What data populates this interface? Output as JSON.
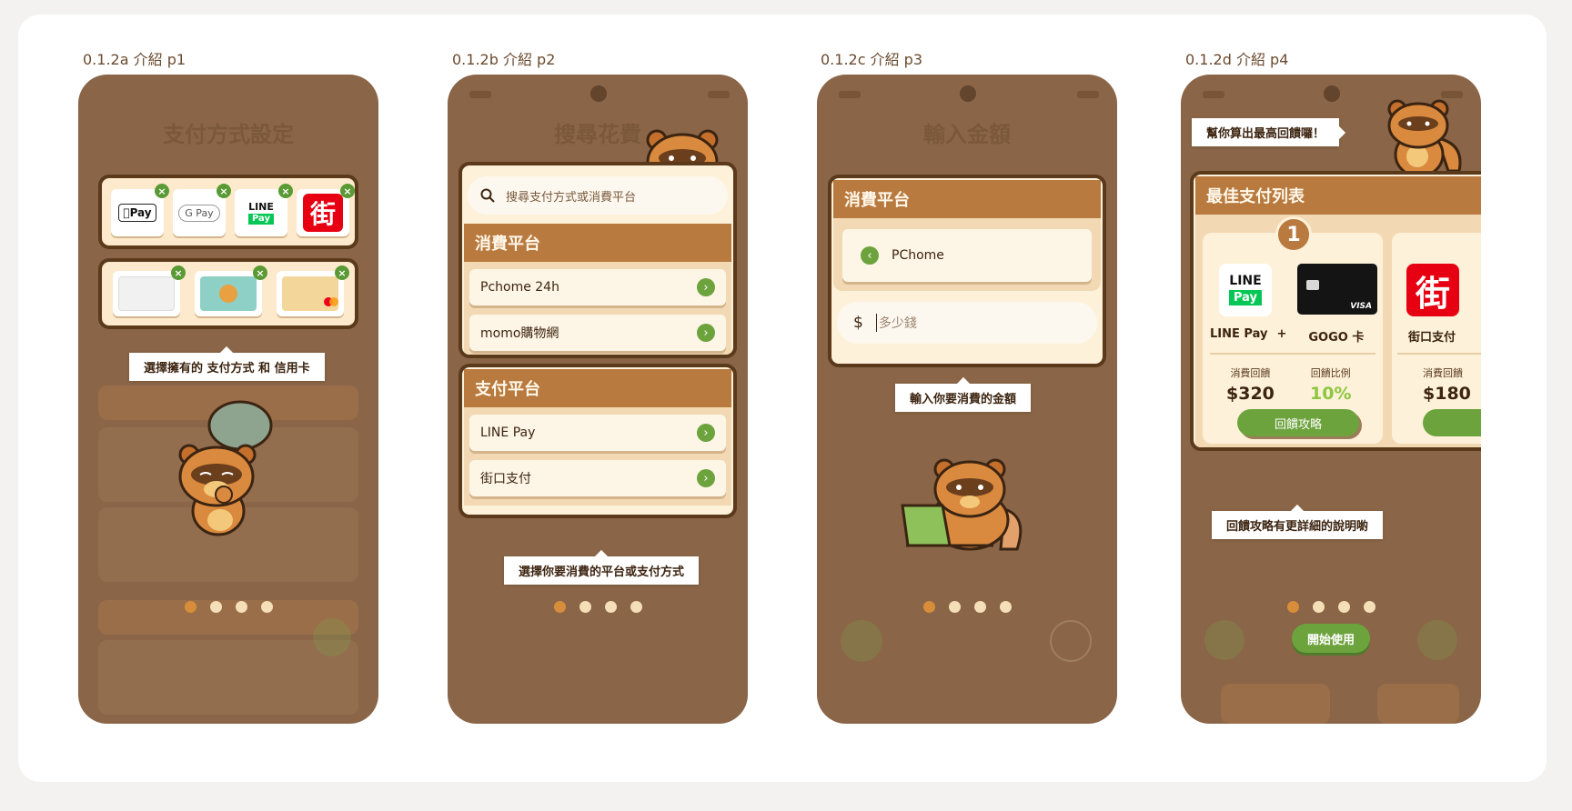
{
  "frames": [
    {
      "label": "0.1.2a 介紹 p1",
      "ghost_title": "支付方式設定",
      "tip": "選擇擁有的 支付方式 和 信用卡",
      "payment_tiles": [
        {
          "name": "apple-pay",
          "text": "Pay"
        },
        {
          "name": "google-pay",
          "text": "G Pay"
        },
        {
          "name": "line-pay",
          "text_top": "LINE",
          "text_bottom": "Pay"
        },
        {
          "name": "jkopay",
          "text": "街"
        }
      ]
    },
    {
      "label": "0.1.2b 介紹 p2",
      "ghost_title": "搜尋花費",
      "search_placeholder": "搜尋支付方式或消費平台",
      "consume_header": "消費平台",
      "consume_items": [
        "Pchome 24h",
        "momo購物網"
      ],
      "pay_header": "支付平台",
      "pay_items": [
        "LINE Pay",
        "街口支付"
      ],
      "tip": "選擇你要消費的平台或支付方式"
    },
    {
      "label": "0.1.2c 介紹 p3",
      "ghost_title": "輸入金額",
      "consume_header": "消費平台",
      "selected": "PChome",
      "currency": "$",
      "amount_placeholder": "多少錢",
      "tip": "輸入你要消費的金額"
    },
    {
      "label": "0.1.2d 介紹 p4",
      "speech": "幫你算出最高回饋囉！",
      "list_header": "最佳支付列表",
      "rank": "1",
      "logo_line_top": "LINE",
      "logo_line_bottom": "Pay",
      "logo_jko": "街",
      "card_left": "LINE Pay",
      "card_plus": "+",
      "card_right": "GOGO 卡",
      "card_third": "街口支付",
      "reward_label": "消費回饋",
      "reward_value": "$320",
      "ratio_label": "回饋比例",
      "ratio_value": "10%",
      "third_reward_label": "消費回饋",
      "third_reward_value": "$180",
      "strategy_button": "回饋攻略",
      "tip": "回饋攻略有更詳細的說明喲",
      "start_button": "開始使用"
    }
  ],
  "colors": {
    "phone_bg": "#8a6547",
    "panel_head": "#b97a3f",
    "accent_green": "#6da33d",
    "dot_active": "#d88d3a",
    "dot_inactive": "#f5dfb8"
  },
  "pagination": {
    "total": 4,
    "active_index": 0
  }
}
